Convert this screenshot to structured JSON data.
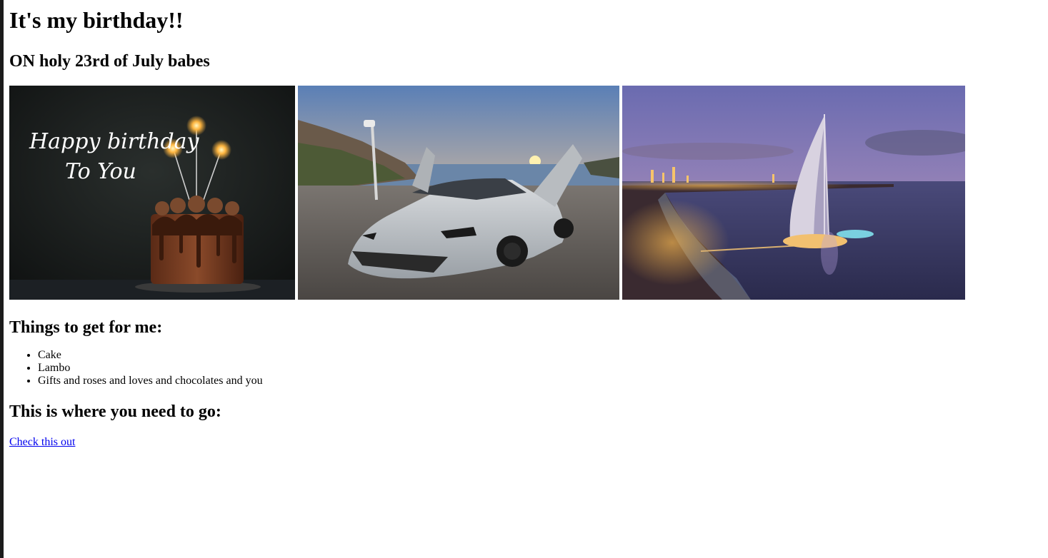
{
  "header": {
    "title": "It's my birthday!!",
    "subtitle": "ON holy 23rd of July babes"
  },
  "gallery": {
    "cake_caption_line1": "Happy birthday",
    "cake_caption_line2": "To You"
  },
  "wishlist": {
    "heading": "Things to get for me:",
    "items": [
      "Cake",
      "Lambo",
      "Gifts and roses and loves and chocolates and you"
    ]
  },
  "destination": {
    "heading": "This is where you need to go:",
    "link_text": "Check this out"
  }
}
